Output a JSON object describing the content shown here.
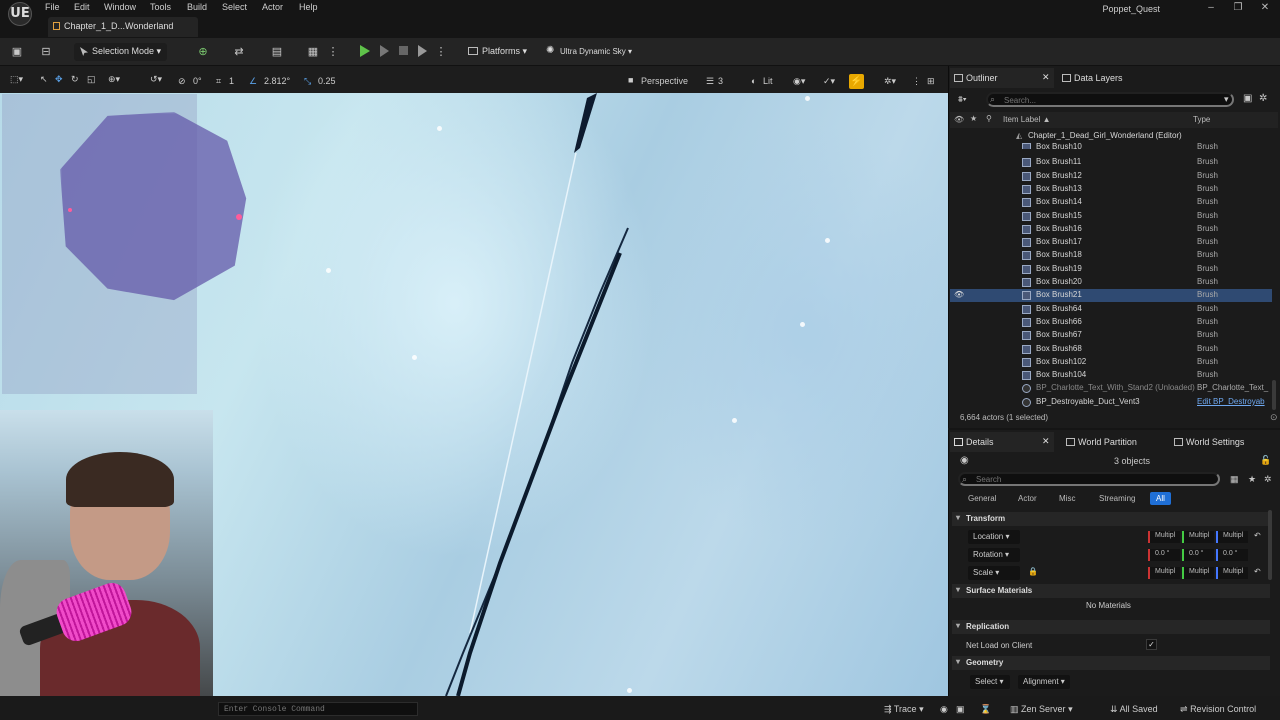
{
  "app": {
    "project": "Poppet_Quest",
    "logo": "UE"
  },
  "menu": [
    "File",
    "Edit",
    "Window",
    "Tools",
    "Build",
    "Select",
    "Actor",
    "Help"
  ],
  "level_tab": "Chapter_1_D...Wonderland",
  "toolbar": {
    "selection_mode": "Selection Mode",
    "platforms": "Platforms",
    "sky": "Ultra Dynamic Sky"
  },
  "viewport_toolbar": {
    "rotation_snap": "0°",
    "grid": "1",
    "scale_snap": "2.812°",
    "camera_speed": "0.25",
    "perspective": "Perspective",
    "view_mode": "Lit",
    "fov": "3"
  },
  "console": {
    "placeholder": "Enter Console Command"
  },
  "outliner": {
    "tab": "Outliner",
    "tab2": "Data Layers",
    "search_placeholder": "Search...",
    "col_label": "Item Label ▲",
    "col_type": "Type",
    "root": "Chapter_1_Dead_Girl_Wonderland (Editor)",
    "rows": [
      {
        "label": "Box Brush10",
        "type": "Brush"
      },
      {
        "label": "Box Brush11",
        "type": "Brush"
      },
      {
        "label": "Box Brush12",
        "type": "Brush"
      },
      {
        "label": "Box Brush13",
        "type": "Brush"
      },
      {
        "label": "Box Brush14",
        "type": "Brush"
      },
      {
        "label": "Box Brush15",
        "type": "Brush"
      },
      {
        "label": "Box Brush16",
        "type": "Brush"
      },
      {
        "label": "Box Brush17",
        "type": "Brush"
      },
      {
        "label": "Box Brush18",
        "type": "Brush"
      },
      {
        "label": "Box Brush19",
        "type": "Brush"
      },
      {
        "label": "Box Brush20",
        "type": "Brush"
      },
      {
        "label": "Box Brush21",
        "type": "Brush"
      },
      {
        "label": "Box Brush64",
        "type": "Brush"
      },
      {
        "label": "Box Brush66",
        "type": "Brush"
      },
      {
        "label": "Box Brush67",
        "type": "Brush"
      },
      {
        "label": "Box Brush68",
        "type": "Brush"
      },
      {
        "label": "Box Brush102",
        "type": "Brush"
      },
      {
        "label": "Box Brush104",
        "type": "Brush"
      },
      {
        "label": "BP_Charlotte_Text_With_Stand2 (Unloaded)",
        "type": "BP_Charlotte_Text_"
      },
      {
        "label": "BP_Destroyable_Duct_Vent3",
        "type": "Edit BP_Destroyab"
      }
    ],
    "actors_count": "6,664 actors (1 selected)"
  },
  "details": {
    "tab": "Details",
    "tab2": "World Partition",
    "tab3": "World Settings",
    "objects": "3 objects",
    "search_placeholder": "Search",
    "filters": [
      "General",
      "Actor",
      "Misc",
      "Streaming",
      "All"
    ],
    "sections": {
      "transform": "Transform",
      "surface": "Surface Materials",
      "replication": "Replication",
      "geometry": "Geometry"
    },
    "location": "Location",
    "rotation": "Rotation",
    "scale": "Scale",
    "multi": "Multipl",
    "zero": "0.0 °",
    "no_materials": "No Materials",
    "net_load": "Net Load on Client",
    "select": "Select",
    "alignment": "Alignment"
  },
  "status": {
    "trace": "Trace",
    "zen": "Zen Server",
    "saved": "All Saved",
    "revision": "Revision Control"
  },
  "colors": {
    "accent": "#1f6fd6",
    "selected_row": "#2f4a72",
    "snap": "#e8a800"
  }
}
